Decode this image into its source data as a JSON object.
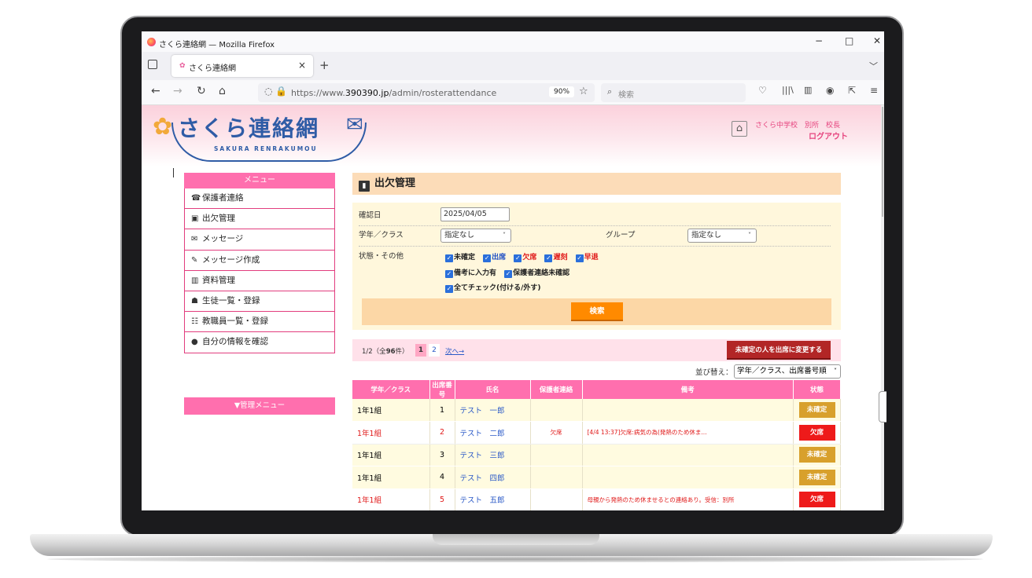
{
  "window": {
    "title": "さくら連絡網 — Mozilla Firefox"
  },
  "tab": {
    "title": "さくら連絡網",
    "close": "×",
    "new": "+"
  },
  "nav": {
    "url_prefix": "https://www.",
    "url_domain": "390390.jp",
    "url_path": "/admin/rosterattendance",
    "zoom": "90%",
    "search_placeholder": "検索"
  },
  "header": {
    "logo_text": "さくら連絡網",
    "logo_sub": "SAKURA RENRAKUMOU",
    "user_info": "さくら中学校　別所　校長",
    "logout": "ログアウト"
  },
  "menu": {
    "title": "メニュー",
    "items": [
      {
        "label": "保護者連絡",
        "icon": "person-phone-icon"
      },
      {
        "label": "出欠管理",
        "icon": "roster-book-icon"
      },
      {
        "label": "メッセージ",
        "icon": "envelope-icon"
      },
      {
        "label": "メッセージ作成",
        "icon": "compose-icon"
      },
      {
        "label": "資料管理",
        "icon": "books-icon"
      },
      {
        "label": "生徒一覧・登録",
        "icon": "students-icon"
      },
      {
        "label": "教職員一覧・登録",
        "icon": "staff-icon"
      },
      {
        "label": "自分の情報を確認",
        "icon": "user-icon"
      }
    ],
    "admin": "▼管理メニュー"
  },
  "main": {
    "title": "出欠管理",
    "filter": {
      "date_label": "確認日",
      "date_value": "2025/04/05",
      "class_label": "学年／クラス",
      "class_value": "指定なし",
      "group_label": "グループ",
      "group_value": "指定なし",
      "status_label": "状態・その他",
      "checks_row1": [
        "未確定",
        "出席",
        "欠席",
        "遅刻",
        "早退"
      ],
      "checks_row2": [
        "備考に入力有",
        "保護者連絡未確認"
      ],
      "checks_row3": [
        "全てチェック(付ける/外す)"
      ],
      "search_button": "検索"
    },
    "pager": {
      "info_pre": "1/2（全",
      "info_count": "96",
      "info_post": "件）",
      "page1": "1",
      "page2": "2",
      "next": "次へ→",
      "change_button": "未確定の人を出席に変更する"
    },
    "sort": {
      "label": "並び替え：",
      "value": "学年／クラス、出席番号順"
    },
    "table": {
      "headers": [
        "学年／クラス",
        "出席番号",
        "氏名",
        "保護者連絡",
        "備考",
        "状態"
      ],
      "rows": [
        {
          "class": "1年1組",
          "num": "1",
          "name": "テスト　一郎",
          "parent": "",
          "note": "",
          "status": "未確定"
        },
        {
          "class": "1年1組",
          "num": "2",
          "name": "テスト　二郎",
          "parent": "欠席",
          "note": "[4/4 13:37]欠席:病気の為(発熱のため休ま...",
          "status": "欠席"
        },
        {
          "class": "1年1組",
          "num": "3",
          "name": "テスト　三郎",
          "parent": "",
          "note": "",
          "status": "未確定"
        },
        {
          "class": "1年1組",
          "num": "4",
          "name": "テスト　四郎",
          "parent": "",
          "note": "",
          "status": "未確定"
        },
        {
          "class": "1年1組",
          "num": "5",
          "name": "テスト　五郎",
          "parent": "",
          "note": "母親から発熱のため休ませるとの連絡あり。受信：別所",
          "status": "欠席"
        }
      ]
    }
  }
}
